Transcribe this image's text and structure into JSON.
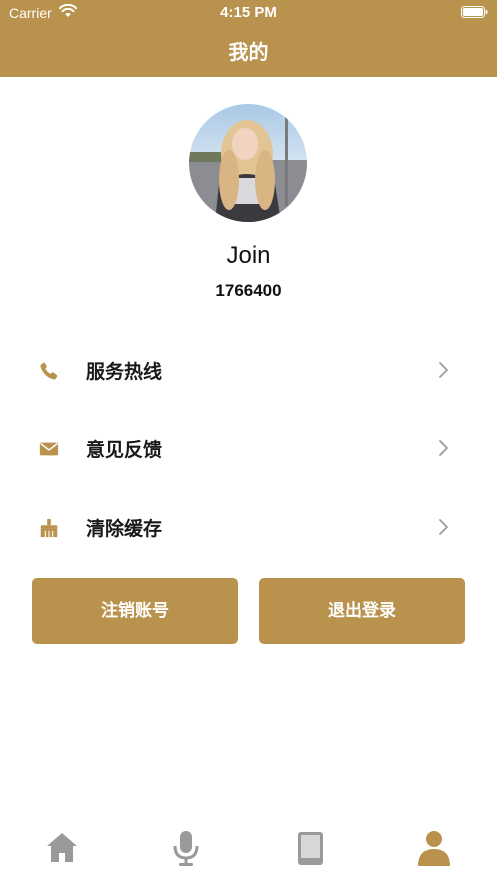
{
  "status_bar": {
    "carrier": "Carrier",
    "time": "4:15 PM"
  },
  "header": {
    "title": "我的"
  },
  "profile": {
    "avatar_alt": "user-avatar",
    "username": "Join",
    "user_id": "1766400"
  },
  "menu": {
    "items": [
      {
        "label": "服务热线",
        "icon": "phone-icon"
      },
      {
        "label": "意见反馈",
        "icon": "envelope-icon"
      },
      {
        "label": "清除缓存",
        "icon": "broom-icon"
      }
    ]
  },
  "buttons": {
    "cancel_account": "注销账号",
    "logout": "退出登录"
  },
  "tabbar": {
    "tabs": [
      {
        "icon": "home-icon",
        "active": false
      },
      {
        "icon": "microphone-icon",
        "active": false
      },
      {
        "icon": "book-icon",
        "active": false
      },
      {
        "icon": "user-icon",
        "active": true
      }
    ]
  },
  "colors": {
    "accent": "#b9924d",
    "tab_inactive": "#9a9a9a",
    "chevron": "#9a9aa2"
  }
}
